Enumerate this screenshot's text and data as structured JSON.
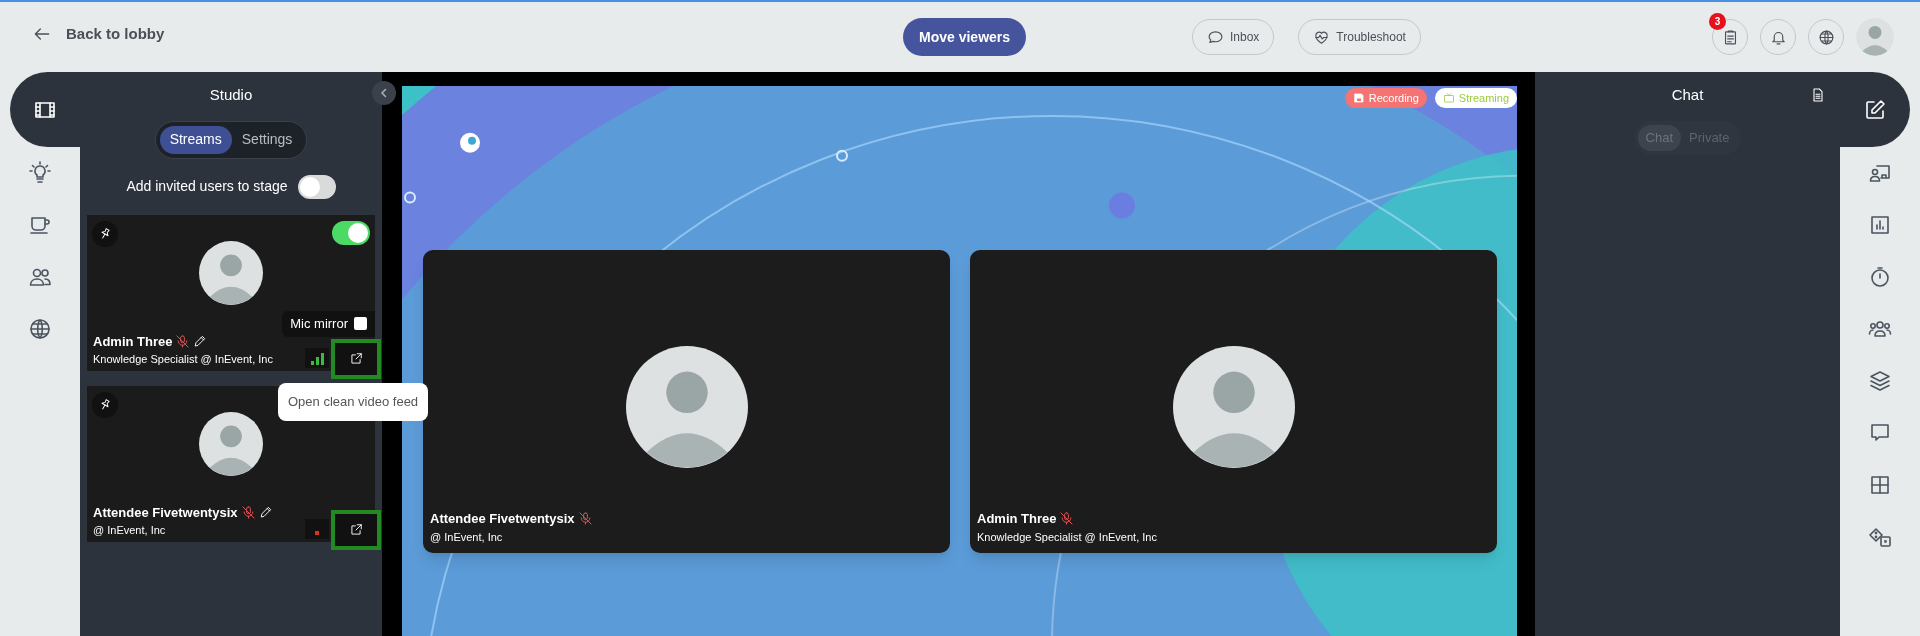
{
  "top_bar": {
    "back_label": "Back to lobby",
    "primary_button": "Move viewers",
    "buttons": [
      {
        "label": "Inbox",
        "kind": "inbox"
      },
      {
        "label": "Troubleshoot",
        "kind": "troubleshoot"
      }
    ],
    "icon_buttons": [
      {
        "kind": "clipboard",
        "badge": "3"
      },
      {
        "kind": "bell"
      },
      {
        "kind": "globe"
      },
      {
        "kind": "avatar"
      }
    ]
  },
  "left_rail": [
    {
      "kind": "film",
      "selected": true
    },
    {
      "kind": "bulb",
      "selected": false
    },
    {
      "kind": "cup",
      "selected": false
    },
    {
      "kind": "users",
      "selected": false
    },
    {
      "kind": "globe",
      "selected": false
    }
  ],
  "studio": {
    "title": "Studio",
    "tabs": [
      {
        "label": "Streams",
        "selected": true
      },
      {
        "label": "Settings",
        "selected": false
      }
    ],
    "invite_toggle": {
      "label": "Add invited users to stage",
      "on": false
    },
    "streams": [
      {
        "name": "Admin Three",
        "subtitle": "Knowledge Specialist @ InEvent, Inc",
        "stage_toggle": {
          "on": true
        },
        "muted": true,
        "editable": true,
        "signal": {
          "kind": "bars"
        },
        "mic_mirror": {
          "label": "Mic mirror",
          "checked": false
        },
        "feed_button": {
          "highlighted": true
        }
      },
      {
        "name": "Attendee Fivetwentysix",
        "subtitle": "@ InEvent, Inc",
        "muted": true,
        "editable": true,
        "signal": {
          "kind": "dot"
        },
        "feed_button": {
          "highlighted": true
        }
      }
    ]
  },
  "tooltip": "Open clean video feed",
  "stage": {
    "badges": [
      {
        "label": "Recording",
        "kind": "recording"
      },
      {
        "label": "Streaming",
        "kind": "streaming"
      }
    ],
    "tiles": [
      {
        "name": "Attendee Fivetwentysix",
        "subtitle": "@ InEvent, Inc",
        "muted": true
      },
      {
        "name": "Admin Three",
        "subtitle": "Knowledge Specialist @ InEvent, Inc",
        "muted": true
      }
    ]
  },
  "chat": {
    "title": "Chat",
    "tabs": [
      {
        "label": "Chat",
        "selected": true
      },
      {
        "label": "Private",
        "selected": false
      }
    ]
  },
  "right_rail": [
    {
      "kind": "edit",
      "selected": true
    },
    {
      "kind": "presenter",
      "selected": false
    },
    {
      "kind": "chart",
      "selected": false
    },
    {
      "kind": "timer",
      "selected": false
    },
    {
      "kind": "group",
      "selected": false
    },
    {
      "kind": "layers",
      "selected": false
    },
    {
      "kind": "comment",
      "selected": false
    },
    {
      "kind": "grid",
      "selected": false
    },
    {
      "kind": "dice",
      "selected": false
    }
  ]
}
